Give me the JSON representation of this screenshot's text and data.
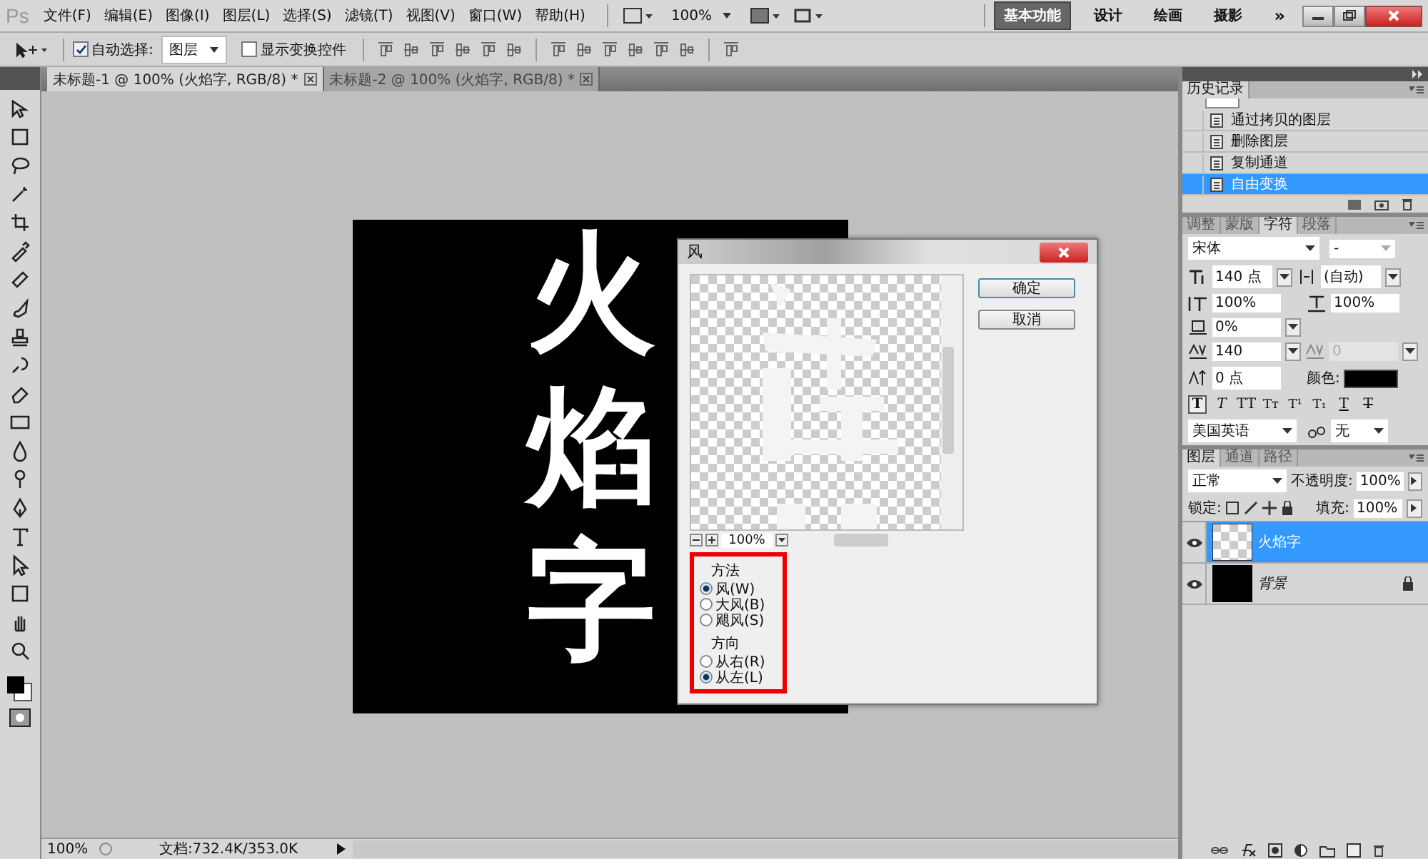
{
  "menu_bar": {
    "logo": "Ps",
    "menus": [
      "文件(F)",
      "编辑(E)",
      "图像(I)",
      "图层(L)",
      "选择(S)",
      "滤镜(T)",
      "视图(V)",
      "窗口(W)",
      "帮助(H)"
    ],
    "zoom": "100%",
    "workspaces": [
      {
        "label": "基本功能",
        "selected": true
      },
      {
        "label": "设计",
        "selected": false
      },
      {
        "label": "绘画",
        "selected": false
      },
      {
        "label": "摄影",
        "selected": false
      }
    ],
    "more": "»"
  },
  "options_bar": {
    "auto_select": {
      "label": "自动选择:",
      "checked": true
    },
    "target": "图层",
    "show_transform": {
      "label": "显示变换控件",
      "checked": false
    }
  },
  "doc_tabs": [
    {
      "title": "未标题-1 @ 100% (火焰字, RGB/8) *",
      "selected": true
    },
    {
      "title": "未标题-2 @ 100% (火焰字, RGB/8) *",
      "selected": false
    }
  ],
  "canvas": {
    "text": "火焰字"
  },
  "dialog": {
    "title": "风",
    "zoom": "100%",
    "buttons": [
      "确定",
      "取消"
    ],
    "highlighted": true,
    "groups": [
      {
        "title": "方法",
        "options": [
          {
            "label": "风(W)",
            "selected": true
          },
          {
            "label": "大风(B)",
            "selected": false
          },
          {
            "label": "飓风(S)",
            "selected": false
          }
        ]
      },
      {
        "title": "方向",
        "options": [
          {
            "label": "从右(R)",
            "selected": false
          },
          {
            "label": "从左(L)",
            "selected": true
          }
        ]
      }
    ]
  },
  "history": {
    "tab": "历史记录",
    "items": [
      {
        "label": "通过拷贝的图层",
        "selected": false
      },
      {
        "label": "删除图层",
        "selected": false
      },
      {
        "label": "复制通道",
        "selected": false
      },
      {
        "label": "自由变换",
        "selected": true
      }
    ]
  },
  "character": {
    "tabs": [
      {
        "label": "调整",
        "selected": false
      },
      {
        "label": "蒙版",
        "selected": false
      },
      {
        "label": "字符",
        "selected": true
      },
      {
        "label": "段落",
        "selected": false
      }
    ],
    "font": "宋体",
    "style": "-",
    "size": "140 点",
    "leading": "(自动)",
    "vscale": "100%",
    "hscale": "100%",
    "tsume": "0%",
    "tracking": "140",
    "kerning": {
      "value": "0",
      "disabled": true
    },
    "baseline": "0 点",
    "color_label": "颜色:",
    "color": "#000000",
    "style_buttons": [
      {
        "label": "T",
        "selected": true
      },
      {
        "label": "T",
        "selected": false
      },
      {
        "label": "TT",
        "selected": false
      },
      {
        "label": "Tт",
        "selected": false
      },
      {
        "label": "T¹",
        "selected": false
      },
      {
        "label": "T₁",
        "selected": false
      },
      {
        "label": "T",
        "selected": false
      },
      {
        "label": "T",
        "selected": false
      }
    ],
    "language": "美国英语",
    "antialias": "无"
  },
  "layers": {
    "tabs": [
      {
        "label": "图层",
        "selected": true
      },
      {
        "label": "通道",
        "selected": false
      },
      {
        "label": "路径",
        "selected": false
      }
    ],
    "blend": "正常",
    "opacity_label": "不透明度:",
    "opacity": "100%",
    "lock_label": "锁定:",
    "fill_label": "填充:",
    "fill": "100%",
    "items": [
      {
        "name": "火焰字",
        "kind": "text",
        "selected": true,
        "locked": false
      },
      {
        "name": "背景",
        "kind": "background",
        "selected": false,
        "locked": true
      }
    ]
  },
  "status_bar": {
    "zoom": "100%",
    "doc": "文档:732.4K/353.0K"
  }
}
